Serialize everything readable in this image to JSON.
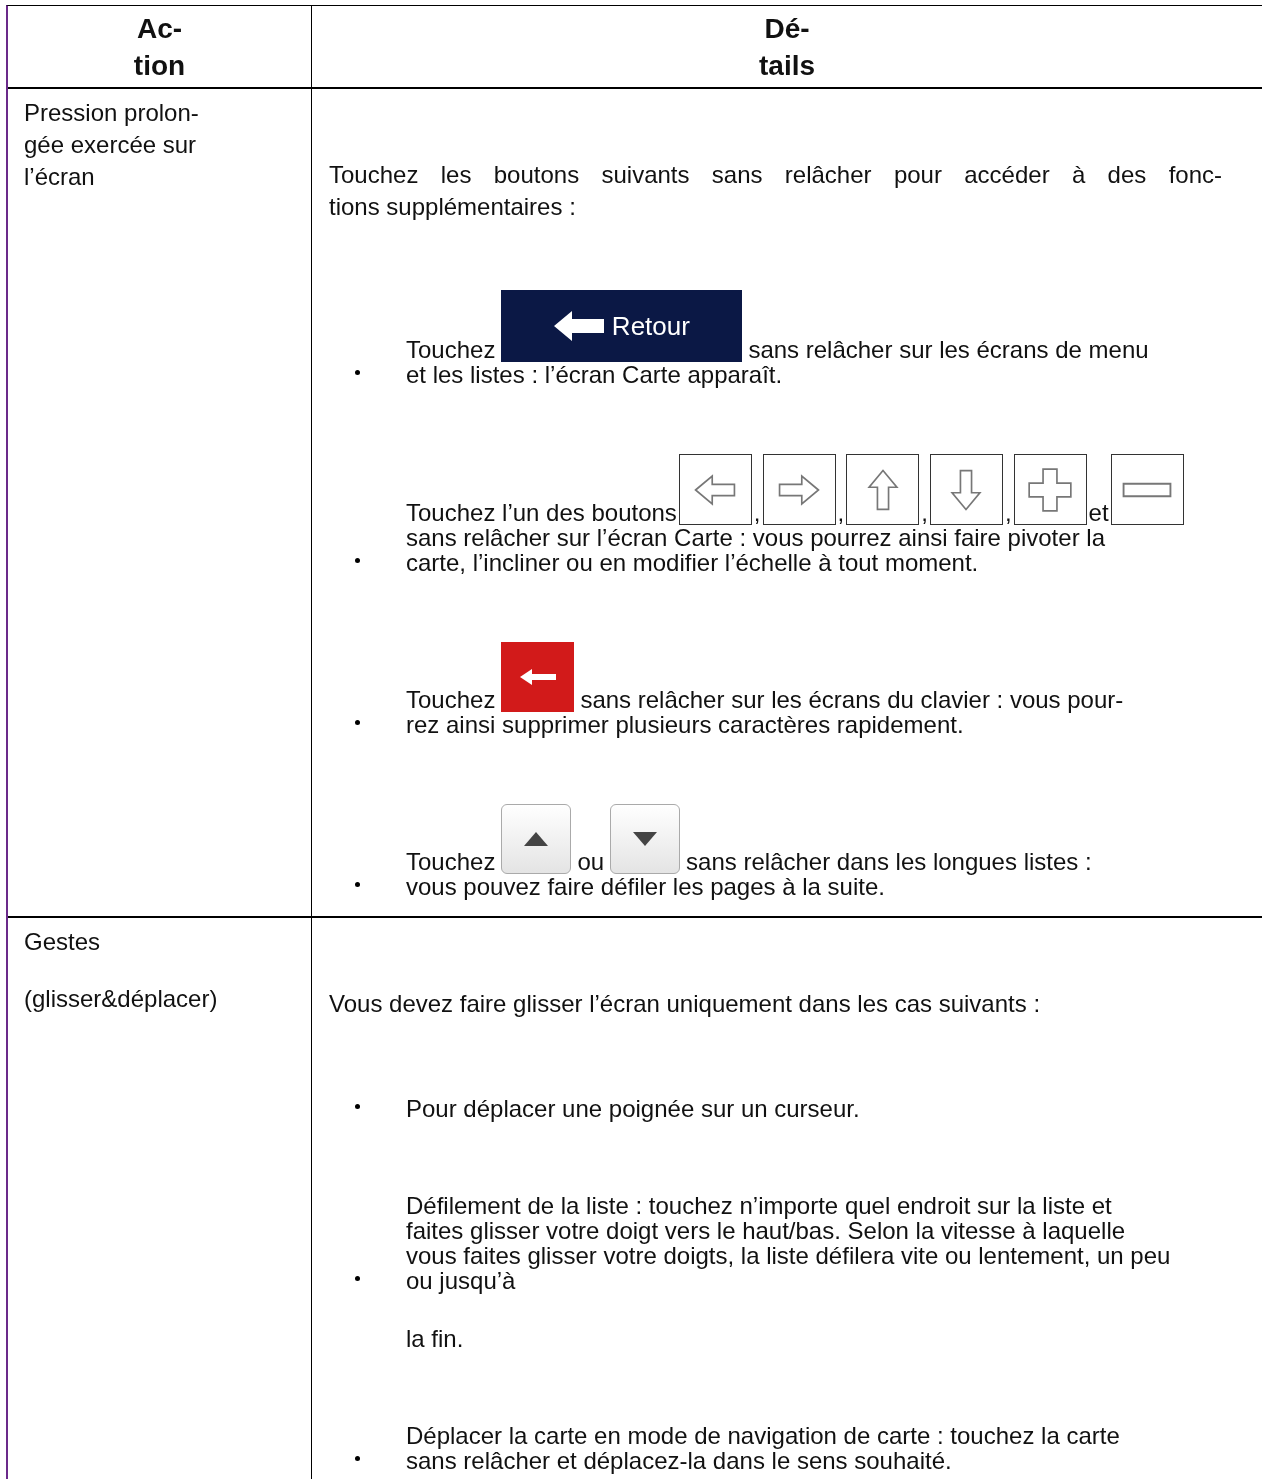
{
  "table": {
    "columns": [
      {
        "lines": [
          "Ac-",
          "tion"
        ]
      },
      {
        "lines": [
          "Dé-",
          "tails"
        ]
      }
    ],
    "rows": [
      {
        "action": [
          {
            "lines": [
              "Pression prolon-",
              "gée exercée sur",
              "l’écran"
            ]
          }
        ],
        "intro": [
          "Touchez les boutons suivants sans relâcher pour accéder à des fonc-",
          "tions supplémentaires :"
        ],
        "bullets": [
          {
            "lines": [
              [
                {
                  "kind": "text",
                  "text": "Touchez"
                },
                {
                  "kind": "back-button",
                  "label": "Retour"
                },
                {
                  "kind": "text",
                  "text": "sans relâcher sur les écrans de menu"
                }
              ],
              [
                {
                  "kind": "text",
                  "text": "et les listes : l’écran Carte apparaît."
                }
              ]
            ]
          },
          {
            "lines": [
              [
                {
                  "kind": "text",
                  "text": "Touchez l’un des boutons"
                },
                {
                  "kind": "left-button"
                },
                {
                  "kind": "text",
                  "text": ","
                },
                {
                  "kind": "right-button"
                },
                {
                  "kind": "text",
                  "text": ","
                },
                {
                  "kind": "up-button"
                },
                {
                  "kind": "text",
                  "text": ","
                },
                {
                  "kind": "down-button"
                },
                {
                  "kind": "text",
                  "text": ","
                },
                {
                  "kind": "zoom-in-button"
                },
                {
                  "kind": "text",
                  "text": "et"
                },
                {
                  "kind": "zoom-out-button"
                }
              ],
              [
                {
                  "kind": "text",
                  "text": "sans relâcher sur l’écran Carte : vous pourrez ainsi faire pivoter la"
                }
              ],
              [
                {
                  "kind": "text",
                  "text": "carte, l’incliner ou en modifier l’échelle à tout moment."
                }
              ]
            ]
          },
          {
            "lines": [
              [
                {
                  "kind": "text",
                  "text": "Touchez"
                },
                {
                  "kind": "delete-button"
                },
                {
                  "kind": "text",
                  "text": "sans relâcher sur les écrans du clavier : vous pour-"
                }
              ],
              [
                {
                  "kind": "text",
                  "text": "rez ainsi supprimer plusieurs caractères rapidement."
                }
              ]
            ]
          },
          {
            "lines": [
              [
                {
                  "kind": "text",
                  "text": "Touchez"
                },
                {
                  "kind": "scroll-up-button"
                },
                {
                  "kind": "text",
                  "text": "ou"
                },
                {
                  "kind": "scroll-down-button"
                },
                {
                  "kind": "text",
                  "text": "sans relâcher dans les longues listes :"
                }
              ],
              [
                {
                  "kind": "text",
                  "text": "vous pouvez faire défiler les pages à la suite."
                }
              ]
            ]
          }
        ]
      },
      {
        "action": [
          {
            "lines": [
              "Gestes"
            ]
          },
          {
            "lines": [
              "(glisser&déplacer)"
            ]
          }
        ],
        "intro": [
          "Vous devez faire glisser l’écran uniquement dans les cas suivants :"
        ],
        "bullets": [
          {
            "lines": [
              [
                {
                  "kind": "text",
                  "text": "Pour déplacer une poignée sur un curseur."
                }
              ]
            ]
          },
          {
            "lines": [
              [
                {
                  "kind": "text",
                  "text": "Défilement de la liste : touchez n’importe quel endroit sur la liste et"
                }
              ],
              [
                {
                  "kind": "text",
                  "text": "faites glisser votre doigt vers le haut/bas. Selon la vitesse à laquelle"
                }
              ],
              [
                {
                  "kind": "text",
                  "text": "vous faites glisser votre doigts, la liste défilera vite ou lentement, un peu"
                }
              ],
              [
                {
                  "kind": "text",
                  "text": "ou jusqu’à"
                }
              ]
            ],
            "continuation": "la fin."
          },
          {
            "lines": [
              [
                {
                  "kind": "text",
                  "text": "Déplacer la carte en mode de navigation de carte : touchez la carte"
                }
              ],
              [
                {
                  "kind": "text",
                  "text": "sans relâcher et déplacez-la dans le sens souhaité."
                }
              ]
            ]
          }
        ]
      }
    ]
  }
}
